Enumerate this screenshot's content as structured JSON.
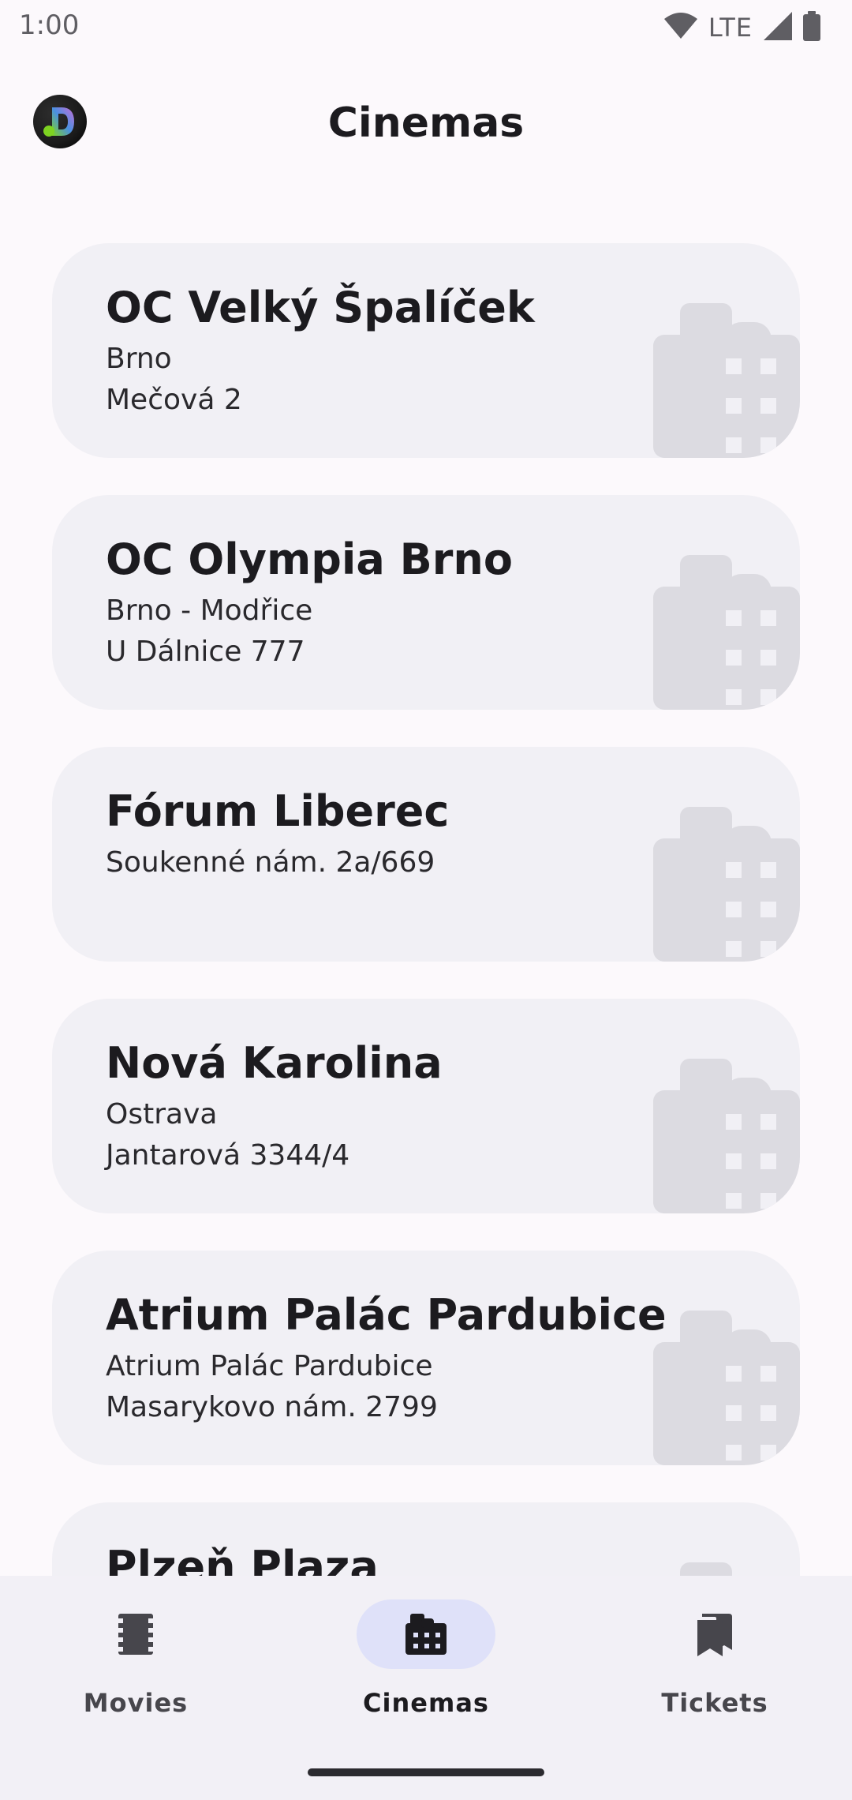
{
  "status_bar": {
    "time": "1:00",
    "network": "LTE",
    "icons": [
      "wifi-icon",
      "signal-icon",
      "battery-icon"
    ]
  },
  "app_bar": {
    "title": "Cinemas",
    "logo_icon": "app-logo-icon"
  },
  "cinemas": [
    {
      "name": "OC Velký Špalíček",
      "line1": "Brno",
      "line2": "Mečová 2"
    },
    {
      "name": "OC Olympia Brno",
      "line1": "Brno - Modřice",
      "line2": "U Dálnice 777"
    },
    {
      "name": "Fórum Liberec",
      "line1": "Soukenné nám. 2a/669",
      "line2": ""
    },
    {
      "name": "Nová Karolina",
      "line1": "Ostrava",
      "line2": "Jantarová 3344/4"
    },
    {
      "name": "Atrium Palác Pardubice",
      "line1": "Atrium Palác Pardubice",
      "line2": "Masarykovo nám. 2799"
    },
    {
      "name": "Plzeň Plaza",
      "line1": "",
      "line2": ""
    }
  ],
  "bottom_nav": {
    "items": [
      {
        "label": "Movies",
        "icon": "movie-icon",
        "active": false
      },
      {
        "label": "Cinemas",
        "icon": "cinema-icon",
        "active": true
      },
      {
        "label": "Tickets",
        "icon": "ticket-icon",
        "active": false
      }
    ]
  },
  "colors": {
    "background": "#fcf9fc",
    "card": "#f1f0f5",
    "nav_background": "#f2f0f6",
    "active_pill": "#dfe1f9",
    "building": "#dcdbe1"
  }
}
